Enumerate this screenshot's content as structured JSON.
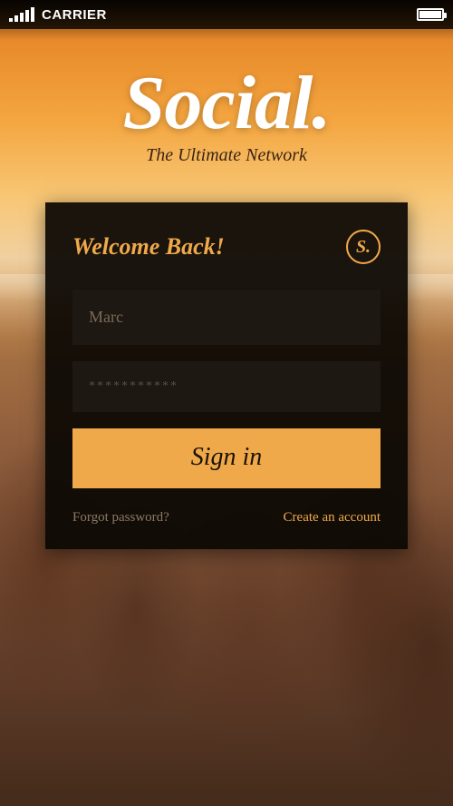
{
  "status": {
    "carrier": "CARRIER"
  },
  "brand": {
    "logo": "Social.",
    "tagline": "The Ultimate Network",
    "badge": "S."
  },
  "card": {
    "welcome": "Welcome Back!",
    "username_value": "Marc",
    "password_mask": "***********",
    "signin_label": "Sign in",
    "forgot_label": "Forgot password?",
    "create_label": "Create an account"
  },
  "colors": {
    "accent": "#f0a94a",
    "card_bg": "#0c0804",
    "field_bg": "#1e1812"
  }
}
